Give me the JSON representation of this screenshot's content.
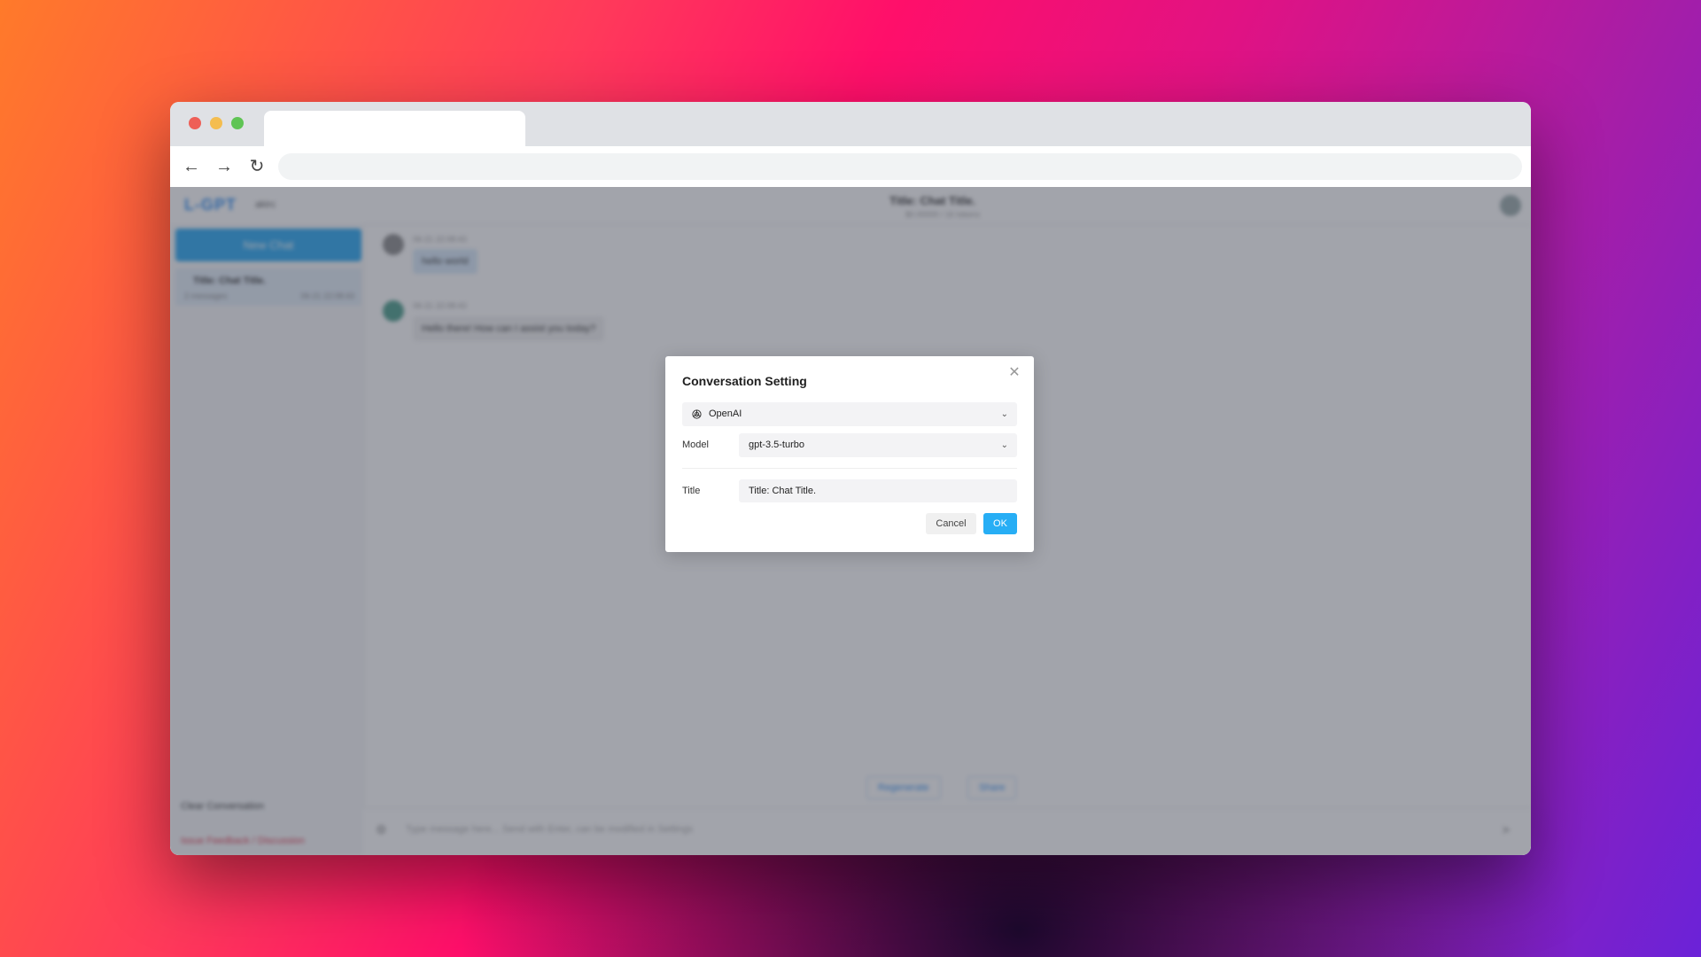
{
  "app": {
    "logo": "L-GPT",
    "header_sub": "akirc",
    "chat_title": "Title: Chat Title.",
    "chat_meta": "$0.00000 / 16 tokens"
  },
  "sidebar": {
    "new_chat_label": "New Chat",
    "conversation": {
      "title": "Title: Chat Title.",
      "sub": "2 messages",
      "time": "06-21 22:08:43"
    },
    "clear_label": "Clear Conversation",
    "feedback_label": "Issue Feedback / Discussion",
    "icons": [
      "moon-icon",
      "github-icon",
      "diamond-icon",
      "translate-icon",
      "settings-icon"
    ]
  },
  "messages": [
    {
      "meta": "06-21 22:08:43",
      "text": "hello world",
      "role": "user"
    },
    {
      "meta": "06-21 22:08:43",
      "text": "Hello there! How can I assist you today?",
      "role": "assistant"
    }
  ],
  "bottom_actions": {
    "regenerate_label": "Regenerate",
    "share_label": "Share"
  },
  "input": {
    "placeholder": "Type message here... Send with Enter, can be modified in Settings"
  },
  "dialog": {
    "title": "Conversation Setting",
    "provider": "OpenAI",
    "model_label": "Model",
    "model_value": "gpt-3.5-turbo",
    "title_label": "Title",
    "title_value": "Title: Chat Title.",
    "cancel_label": "Cancel",
    "ok_label": "OK"
  },
  "colors": {
    "accent": "#27aef5",
    "danger": "#e0334c"
  }
}
